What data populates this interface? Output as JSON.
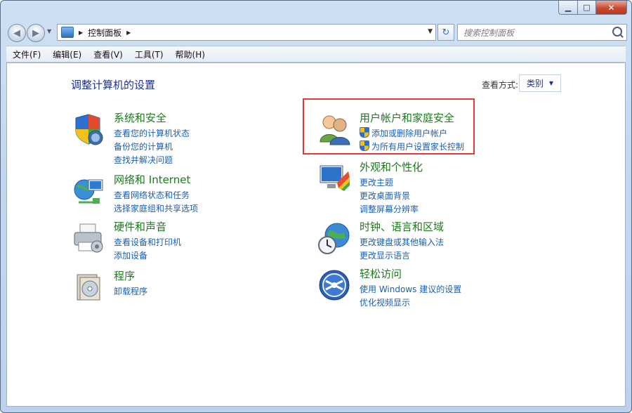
{
  "window": {
    "minimize": "▁",
    "maximize": "□",
    "close": "✕"
  },
  "nav": {
    "back": "◀",
    "forward": "▶",
    "breadcrumb": "控制面板",
    "separator": "▶",
    "search_placeholder": "搜索控制面板"
  },
  "menu": [
    "文件(F)",
    "编辑(E)",
    "查看(V)",
    "工具(T)",
    "帮助(H)"
  ],
  "main": {
    "title": "调整计算机的设置",
    "view_by_label": "查看方式:",
    "view_by_value": "类别"
  },
  "categories": [
    {
      "title": "系统和安全",
      "links": [
        "查看您的计算机状态",
        "备份您的计算机",
        "查找并解决问题"
      ],
      "icon": "shield-icon"
    },
    {
      "title": "网络和 Internet",
      "links": [
        "查看网络状态和任务",
        "选择家庭组和共享选项"
      ],
      "icon": "network-icon"
    },
    {
      "title": "硬件和声音",
      "links": [
        "查看设备和打印机",
        "添加设备"
      ],
      "icon": "printer-icon"
    },
    {
      "title": "程序",
      "links": [
        "卸载程序"
      ],
      "icon": "programs-icon"
    },
    {
      "title": "用户帐户和家庭安全",
      "links": [
        "添加或删除用户帐户",
        "为所有用户设置家长控制"
      ],
      "icon": "users-icon"
    },
    {
      "title": "外观和个性化",
      "links": [
        "更改主题",
        "更改桌面背景",
        "调整屏幕分辨率"
      ],
      "icon": "monitor-icon"
    },
    {
      "title": "时钟、语言和区域",
      "links": [
        "更改键盘或其他输入法",
        "更改显示语言"
      ],
      "icon": "globe-clock-icon"
    },
    {
      "title": "轻松访问",
      "links": [
        "使用 Windows 建议的设置",
        "优化视频显示"
      ],
      "icon": "ease-of-access-icon"
    }
  ],
  "colors": {
    "category_title": "#1d7a1d",
    "link": "#1a5fb4",
    "page_title": "#1e3287",
    "highlight": "#e53935"
  }
}
